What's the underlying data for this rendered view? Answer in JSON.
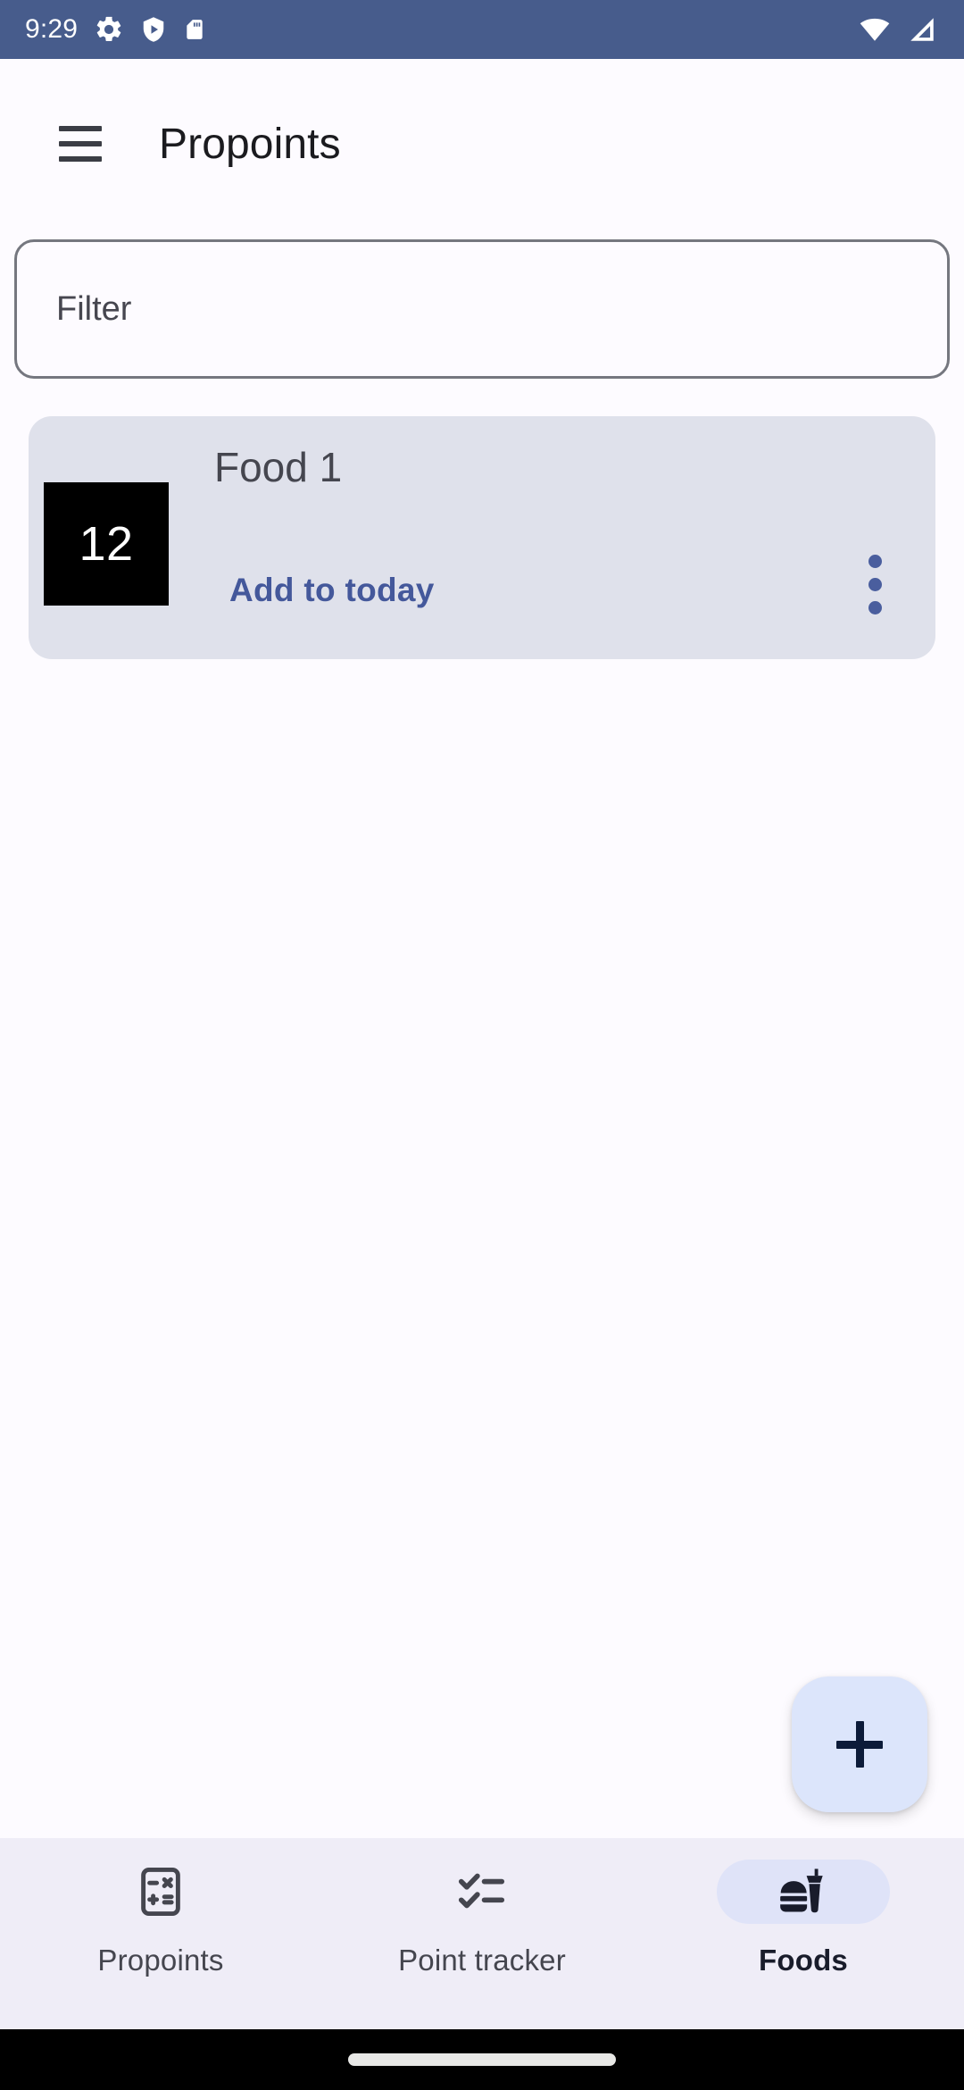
{
  "status_bar": {
    "clock": "9:29",
    "left_icons": [
      "gear-icon",
      "shield-play-icon",
      "sd-card-icon"
    ],
    "right_icons": [
      "wifi-icon",
      "signal-icon"
    ],
    "background_color": "#475C8C",
    "foreground_color": "#FFFFFF"
  },
  "app_bar": {
    "menu_icon": "hamburger-menu-icon",
    "title": "Propoints"
  },
  "filter": {
    "value": "",
    "placeholder": "Filter"
  },
  "foods": [
    {
      "points": "12",
      "name": "Food 1",
      "add_label": "Add to today",
      "overflow_icon": "more-vertical-icon"
    }
  ],
  "fab": {
    "icon": "plus-icon",
    "background_color": "#DCE5FB",
    "icon_color": "#0C1B39"
  },
  "bottom_nav": {
    "items": [
      {
        "label": "Propoints",
        "icon": "calculator-icon",
        "active": false
      },
      {
        "label": "Point tracker",
        "icon": "checklist-icon",
        "active": false
      },
      {
        "label": "Foods",
        "icon": "fastfood-icon",
        "active": true
      }
    ]
  },
  "colors": {
    "accent": "#44589B",
    "card_background": "#DFE1EB",
    "page_background": "#FDFBFF",
    "nav_background": "#EFEDF7",
    "active_pill": "#DFE3F8"
  }
}
